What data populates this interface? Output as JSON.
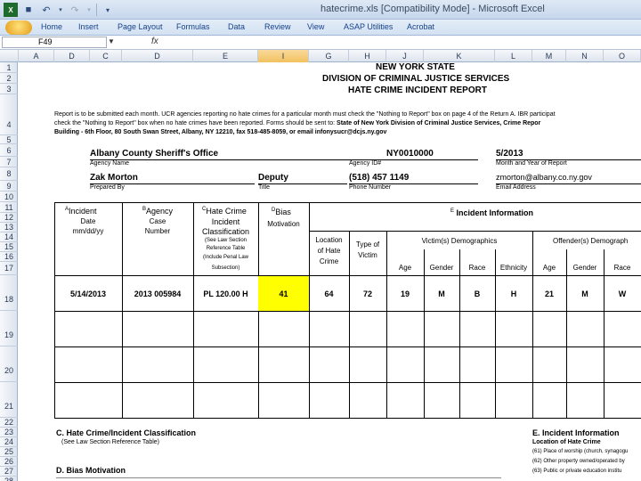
{
  "window": {
    "title": "hatecrime.xls [Compatibility Mode] - Microsoft Excel"
  },
  "ribbon": {
    "tabs": [
      "Home",
      "Insert",
      "Page Layout",
      "Formulas",
      "Data",
      "Review",
      "View",
      "ASAP Utilities",
      "Acrobat"
    ]
  },
  "formula_bar": {
    "name_box": "F49",
    "fx_label": "fx",
    "value": ""
  },
  "columns": [
    "A",
    "D",
    "C",
    "D",
    "E",
    "I",
    "G",
    "H",
    "J",
    "K",
    "L",
    "M",
    "N",
    "O"
  ],
  "selected_column": "I",
  "rows": [
    "1",
    "2",
    "3",
    "4",
    "5",
    "6",
    "7",
    "8",
    "9",
    "10",
    "11",
    "12",
    "13",
    "14",
    "15",
    "16",
    "17",
    "18",
    "19",
    "20",
    "21",
    "22",
    "23",
    "24",
    "25",
    "26",
    "27",
    "28"
  ],
  "report": {
    "title1": "NEW YORK STATE",
    "title2": "DIVISION OF CRIMINAL JUSTICE SERVICES",
    "title3": "HATE CRIME INCIDENT REPORT",
    "instr1": "Report is to be submitted each month.  UCR agencies reporting no hate crimes for a particular month must check the \"Nothing to Report\" box on page 4 of the Return A.  IBR participat",
    "instr2a": "check the \"Nothing to Report\" box when no hate crimes have been reported.  Forms should be sent to:",
    "instr2b": "State of New York Division of Criminal Justice Services, Crime Repor",
    "instr3": "Building - 6th Floor, 80 South Swan Street, Albany, NY 12210,  fax 518-485-8059, or email infonysucr@dcjs.ny.gov",
    "agency_name": "Albany County Sheriff's Office",
    "agency_name_label": "Agency Name",
    "agency_id": "NY0010000",
    "agency_id_label": "Agency ID#",
    "month_year": "5/2013",
    "month_year_label": "Month and Year of Report",
    "prepared_by": "Zak Morton",
    "prepared_by_label": "Prepared By",
    "title_value": "Deputy",
    "title_label": "Title",
    "phone": "(518) 457 1149",
    "phone_label": "Phone Number",
    "email": "zmorton@albany.co.ny.gov",
    "email_label": "Email Address"
  },
  "table_headers": {
    "a_sup": "A",
    "a_label": [
      "Incident",
      "Date",
      "mm/dd/yy"
    ],
    "b_sup": "B",
    "b_label": [
      "Agency",
      "Case",
      "Number"
    ],
    "c_sup": "C",
    "c_label": [
      "Hate Crime",
      "Incident",
      "Classification"
    ],
    "c_note": [
      "(See Law Section",
      "Reference Table",
      "(Include Penal Law",
      "Subsection)"
    ],
    "d_sup": "D",
    "d_label": [
      "Bias",
      "Motivation"
    ],
    "e_sup": "E",
    "e_label": "Incident Information",
    "location": [
      "Location",
      "of Hate",
      "Crime"
    ],
    "type_victim": [
      "Type of",
      "Victim"
    ],
    "victims_demo": "Victim(s) Demographics",
    "offenders_demo": "Offender(s) Demograph",
    "age": "Age",
    "gender": "Gender",
    "race": "Race",
    "ethnicity": "Ethnicity",
    "off_age": "Age",
    "off_gender": "Gender",
    "off_race": "Race"
  },
  "data_row": {
    "date": "5/14/2013",
    "case": "2013 005984",
    "classification": "PL 120.00 H",
    "bias": "41",
    "location": "64",
    "type_victim": "72",
    "v_age": "19",
    "v_gender": "M",
    "v_race": "B",
    "v_ethnicity": "H",
    "o_age": "21",
    "o_gender": "M",
    "o_race": "W"
  },
  "bottom": {
    "c_title": "C. Hate Crime/Incident Classification",
    "c_sub": "(See Law Section Reference Table)",
    "d_title": "D. Bias Motivation",
    "e_title": "E. Incident Information",
    "e_sub": "Location of Hate Crime",
    "e_item1": "(61) Place of worship (church, synagogu",
    "e_item2": "(62) Other property owned/operated by",
    "e_item3": "(63) Public or private education institu"
  }
}
